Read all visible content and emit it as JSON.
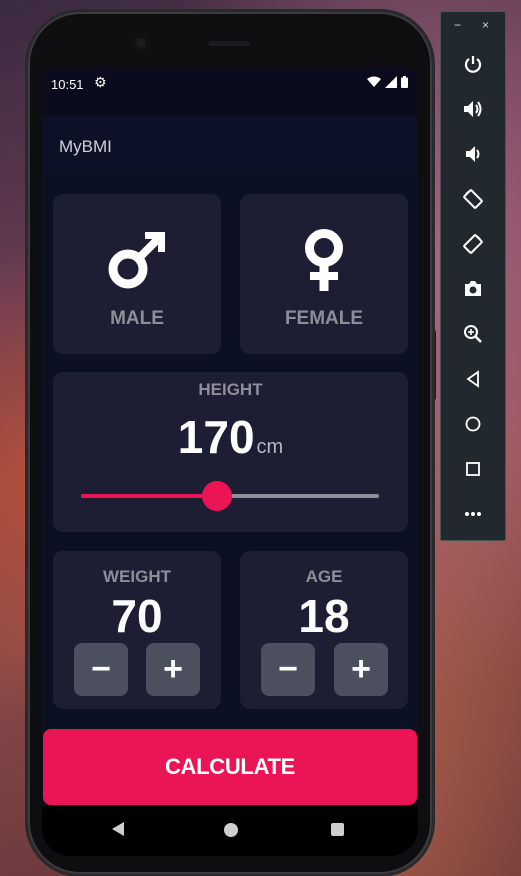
{
  "status_bar": {
    "time": "10:51",
    "settings_icon": "gear-icon",
    "wifi_icon": "wifi-icon",
    "signal_icon": "signal-icon",
    "battery_icon": "battery-icon"
  },
  "app_bar": {
    "title": "MyBMI"
  },
  "gender": {
    "male": {
      "label": "MALE",
      "icon": "mars-icon",
      "symbol": "♂"
    },
    "female": {
      "label": "FEMALE",
      "icon": "venus-icon",
      "symbol": "♀"
    }
  },
  "height": {
    "label": "HEIGHT",
    "value": "170",
    "unit": "cm",
    "slider_fraction": 0.455
  },
  "weight": {
    "label": "WEIGHT",
    "value": "70",
    "decrement": "−",
    "increment": "+"
  },
  "age": {
    "label": "AGE",
    "value": "18",
    "decrement": "−",
    "increment": "+"
  },
  "calculate_button": {
    "label": "CALCULATE"
  },
  "navigation": {
    "back_icon": "back-icon",
    "home_icon": "home-icon",
    "recents_icon": "recents-icon"
  },
  "emulator_toolbar": {
    "minimize": "−",
    "close": "×",
    "items": [
      "power-icon",
      "volume-up-icon",
      "volume-down-icon",
      "rotate-left-icon",
      "rotate-right-icon",
      "camera-icon",
      "zoom-icon",
      "back-icon",
      "home-icon",
      "overview-icon",
      "more-icon"
    ]
  },
  "colors": {
    "accent": "#eb1555",
    "card": "#1d1e33",
    "background": "#0b1022",
    "label": "#8d8e98",
    "button": "#4c4f5e"
  }
}
